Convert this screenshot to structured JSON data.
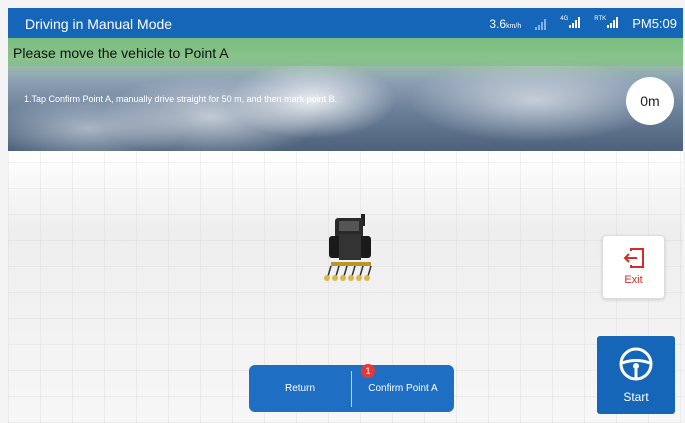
{
  "header": {
    "title": "Driving in Manual Mode",
    "speed_value": "3.6",
    "speed_unit": "km/h",
    "net_label": "4G",
    "rtk_label": "RTK",
    "time": "PM5:09"
  },
  "banner": {
    "prompt": "Please move the vehicle to Point A",
    "instruction": "1.Tap Confirm Point A, manually drive straight for 50 m, and then mark point B.",
    "distance": "0m"
  },
  "controls": {
    "exit_label": "Exit",
    "start_label": "Start"
  },
  "action_bar": {
    "return_label": "Return",
    "confirm_label": "Confirm Point A",
    "badge_count": "1"
  },
  "colors": {
    "primary": "#1565b8",
    "exit_red": "#d62c2c",
    "badge_red": "#e53935"
  }
}
